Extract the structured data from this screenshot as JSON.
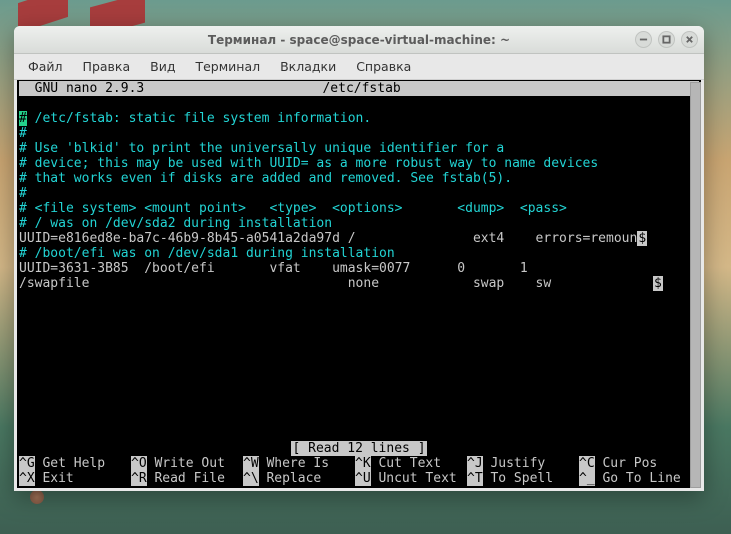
{
  "window": {
    "title": "Терминал - space@space-virtual-machine: ~"
  },
  "menu": {
    "file": "Файл",
    "edit": "Правка",
    "view": "Вид",
    "terminal": "Терминал",
    "tabs": "Вкладки",
    "help": "Справка"
  },
  "nano": {
    "app": "  GNU nano 2.9.3",
    "file": "/etc/fstab",
    "status": "[ Read 12 lines ]",
    "lines": {
      "l0a": "#",
      "l0b": " /etc/fstab: static file system information.",
      "l1": "#",
      "l2": "# Use 'blkid' to print the universally unique identifier for a",
      "l3": "# device; this may be used with UUID= as a more robust way to name devices",
      "l4": "# that works even if disks are added and removed. See fstab(5).",
      "l5": "#",
      "l6": "# <file system> <mount point>   <type>  <options>       <dump>  <pass>",
      "l7": "# / was on /dev/sda2 during installation",
      "l8a": "UUID=e816ed8e-ba7c-46b9-8b45-a0541a2da97d /               ext4    errors=remoun",
      "l8b": "$",
      "l9": "# /boot/efi was on /dev/sda1 during installation",
      "l10": "UUID=3631-3B85  /boot/efi       vfat    umask=0077      0       1",
      "l11a": "/swapfile                                 none            swap    sw             ",
      "l11b": "$"
    },
    "shortcuts": {
      "r1": [
        {
          "key": "^G",
          "label": "Get Help"
        },
        {
          "key": "^O",
          "label": "Write Out"
        },
        {
          "key": "^W",
          "label": "Where Is"
        },
        {
          "key": "^K",
          "label": "Cut Text"
        },
        {
          "key": "^J",
          "label": "Justify"
        },
        {
          "key": "^C",
          "label": "Cur Pos"
        }
      ],
      "r2": [
        {
          "key": "^X",
          "label": "Exit"
        },
        {
          "key": "^R",
          "label": "Read File"
        },
        {
          "key": "^\\",
          "label": "Replace"
        },
        {
          "key": "^U",
          "label": "Uncut Text"
        },
        {
          "key": "^T",
          "label": "To Spell"
        },
        {
          "key": "^_",
          "label": "Go To Line"
        }
      ]
    }
  }
}
